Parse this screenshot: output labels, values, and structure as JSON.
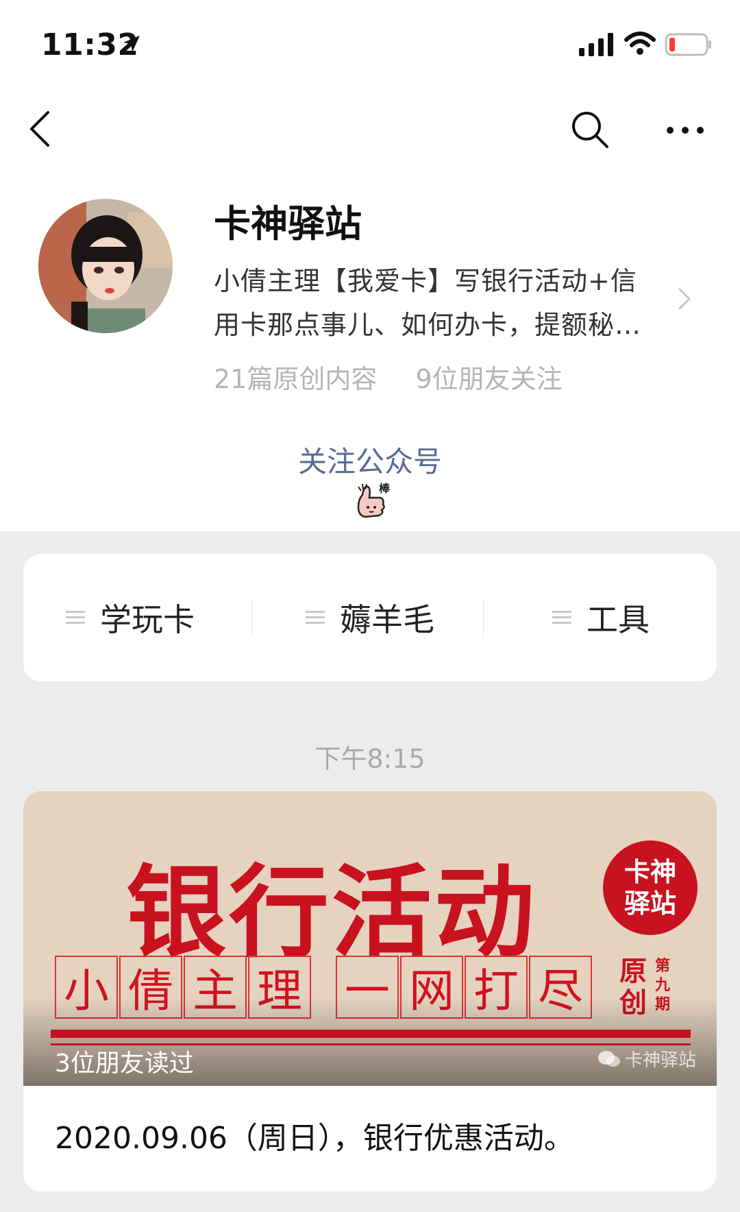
{
  "status_bar": {
    "time": "11:32"
  },
  "profile": {
    "name": "卡神驿站",
    "description_line1": "小倩主理【我爱卡】写银行活动+信",
    "description_line2": "用卡那点事儿、如何办卡，提额秘…",
    "original_count": "21篇原创内容",
    "friends_following": "9位朋友关注",
    "follow_label": "关注公众号"
  },
  "menu": {
    "items": [
      {
        "label": "学玩卡"
      },
      {
        "label": "薅羊毛"
      },
      {
        "label": "工具"
      }
    ]
  },
  "feed": {
    "time_label": "下午8:15",
    "article": {
      "cover_title": "银行活动",
      "cover_sub_left": [
        "小",
        "倩",
        "主",
        "理"
      ],
      "cover_sub_right": [
        "一",
        "网",
        "打",
        "尽"
      ],
      "seal_line1": "卡神",
      "seal_line2": "驿站",
      "original_label": "原创",
      "issue_label": "第九期",
      "friends_read": "3位朋友读过",
      "watermark": "卡神驿站",
      "title": "2020.09.06（周日），银行优惠活动。"
    }
  }
}
